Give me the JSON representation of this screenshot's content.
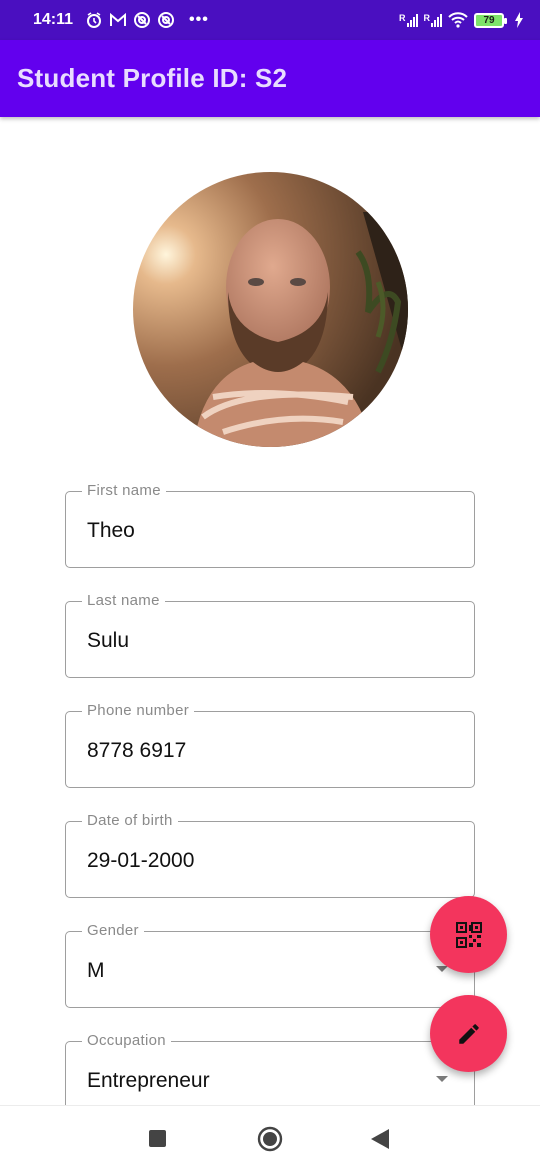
{
  "status_bar": {
    "time": "14:11",
    "notification_icons": [
      "alarm-icon",
      "gmail-icon",
      "vpn-icon",
      "vpn-icon"
    ],
    "overflow": "•••",
    "signal_badge_1": "R",
    "signal_badge_2": "R",
    "battery_level": "79",
    "charging": true
  },
  "app_bar": {
    "title": "Student Profile ID: S2",
    "color": "#6200ee"
  },
  "profile": {
    "fields": [
      {
        "label": "First name",
        "value": "Theo"
      },
      {
        "label": "Last name",
        "value": "Sulu"
      },
      {
        "label": "Phone number",
        "value": "8778 6917"
      },
      {
        "label": "Date of birth",
        "value": "29-01-2000"
      },
      {
        "label": "Gender",
        "value": "M"
      },
      {
        "label": "Occupation",
        "value": "Entrepreneur"
      }
    ]
  },
  "fabs": {
    "qr_icon": "qr-code-icon",
    "edit_icon": "pencil-icon",
    "color": "#f3355d"
  },
  "nav": {
    "icons": [
      "recent-apps-icon",
      "home-icon",
      "back-icon"
    ]
  }
}
